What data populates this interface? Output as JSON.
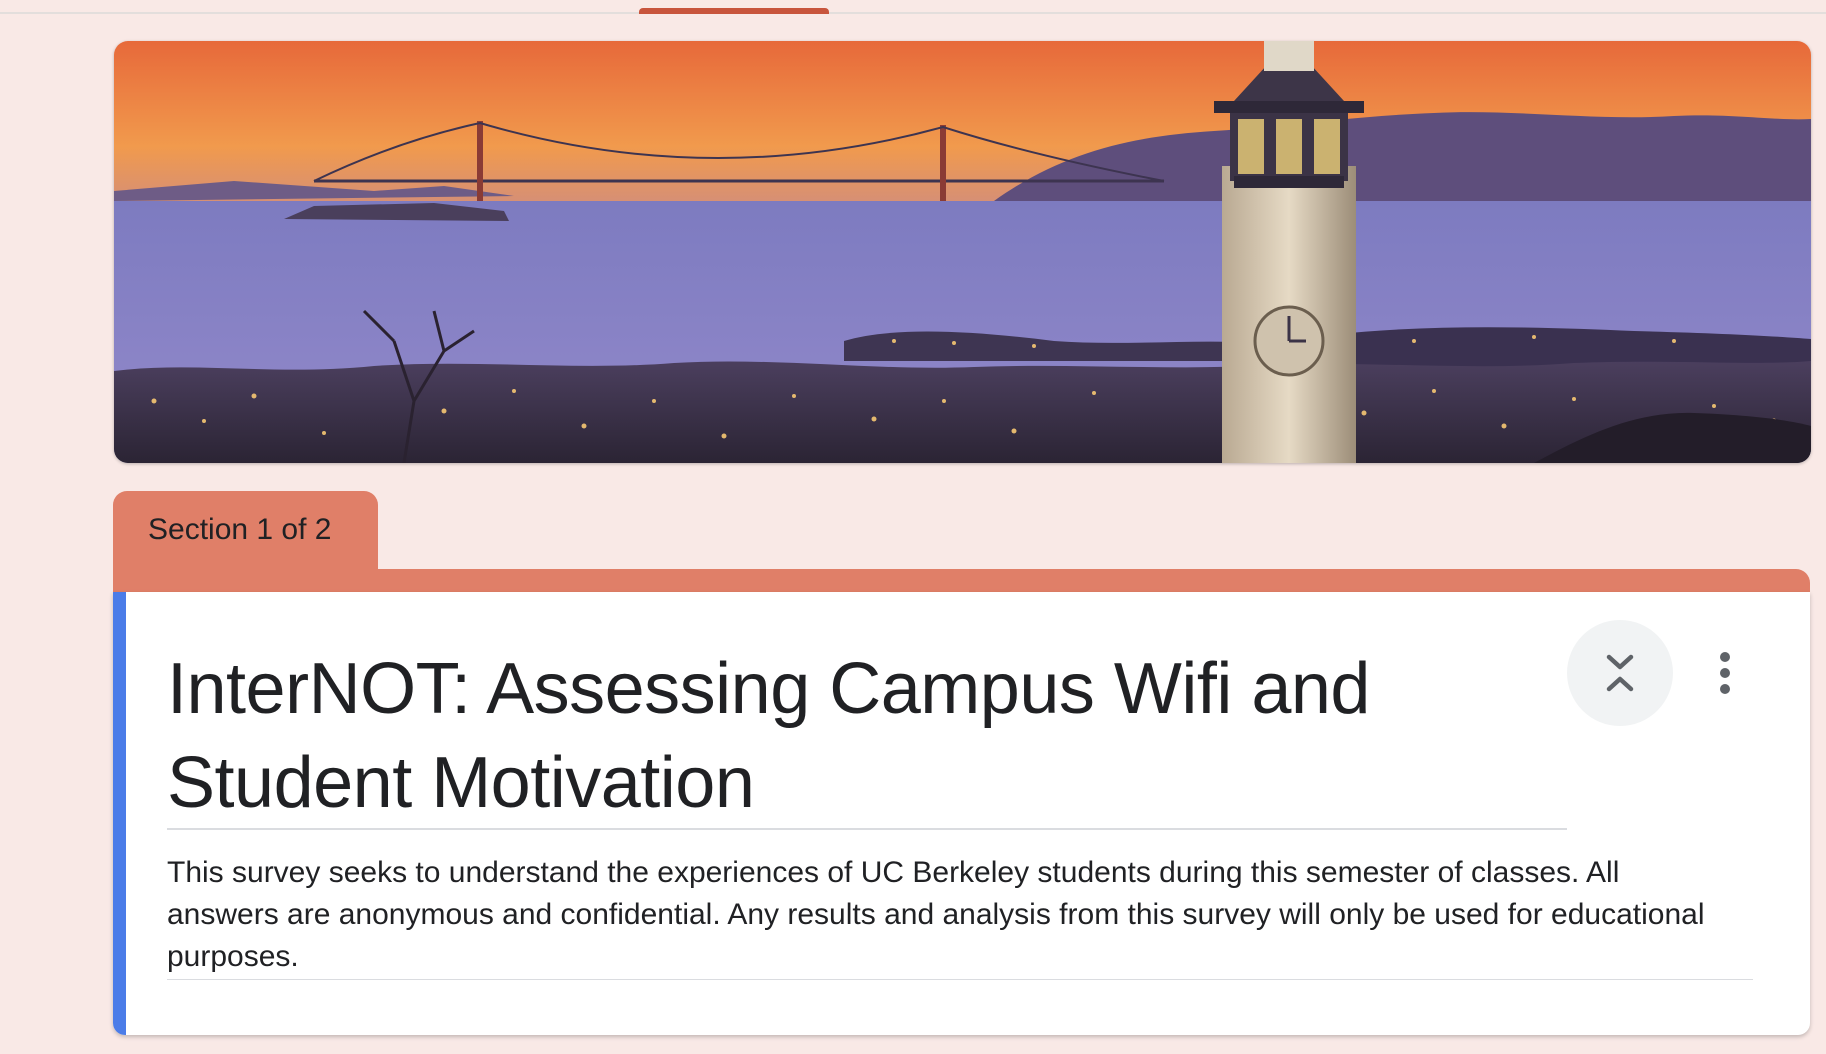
{
  "section_tab": {
    "label": "Section 1 of 2"
  },
  "form": {
    "title": "InterNOT: Assessing Campus Wifi and Student Motivation",
    "description": "This survey seeks to understand the experiences of UC Berkeley students during this semester of classes. All answers are anonymous and confidential. Any results and analysis from this survey will only be used for educational purposes."
  },
  "icons": {
    "collapse": "collapse-section-icon",
    "more": "more-vert-icon"
  },
  "colors": {
    "theme": "#e07f68",
    "tab_indicator": "#c8553d",
    "accent": "#4b7ce8",
    "background": "#f9e9e6"
  }
}
